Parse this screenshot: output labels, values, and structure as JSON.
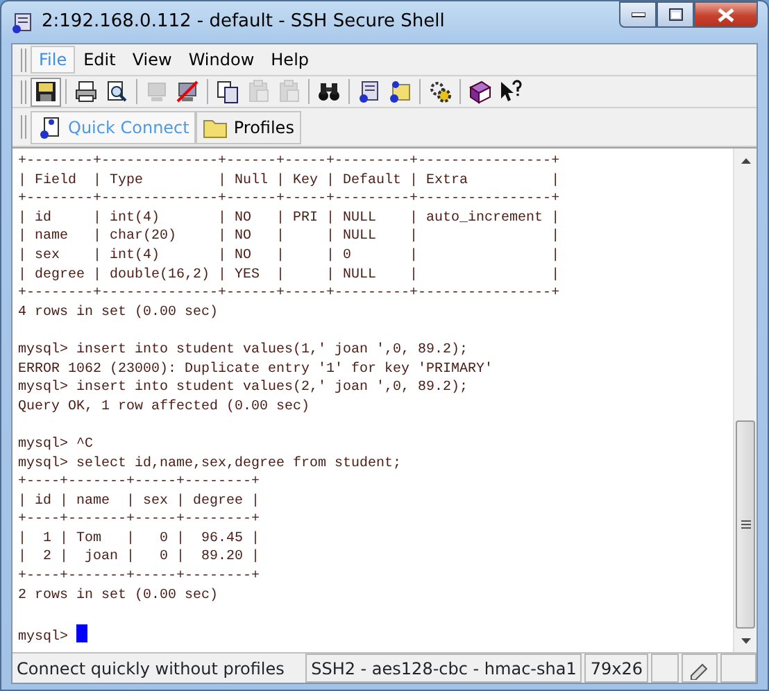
{
  "window": {
    "title": "2:192.168.0.112 - default - SSH Secure Shell"
  },
  "menu": [
    {
      "label": "File",
      "selected": true
    },
    {
      "label": "Edit",
      "selected": false
    },
    {
      "label": "View",
      "selected": false
    },
    {
      "label": "Window",
      "selected": false
    },
    {
      "label": "Help",
      "selected": false
    }
  ],
  "toolbar": [
    {
      "kind": "save",
      "disabled": false
    },
    {
      "kind": "sep"
    },
    {
      "kind": "print",
      "disabled": false
    },
    {
      "kind": "preview",
      "disabled": false
    },
    {
      "kind": "sep"
    },
    {
      "kind": "connect",
      "disabled": true
    },
    {
      "kind": "disconnect",
      "disabled": false
    },
    {
      "kind": "sep"
    },
    {
      "kind": "copy",
      "disabled": false
    },
    {
      "kind": "paste",
      "disabled": true
    },
    {
      "kind": "paste",
      "disabled": true
    },
    {
      "kind": "sep"
    },
    {
      "kind": "find",
      "disabled": false
    },
    {
      "kind": "sep"
    },
    {
      "kind": "terminal",
      "disabled": false
    },
    {
      "kind": "transfer",
      "disabled": false
    },
    {
      "kind": "sep"
    },
    {
      "kind": "settings",
      "disabled": false
    },
    {
      "kind": "sep"
    },
    {
      "kind": "help",
      "disabled": false
    },
    {
      "kind": "whatsthis",
      "disabled": false
    }
  ],
  "tabs": [
    {
      "label": "Quick Connect",
      "kind": "connect",
      "selected": true
    },
    {
      "label": "Profiles",
      "kind": "folder",
      "selected": false
    }
  ],
  "terminal": {
    "blocks": [
      [
        "+--------+--------------+------+-----+---------+----------------+",
        "| Field  | Type         | Null | Key | Default | Extra          |",
        "+--------+--------------+------+-----+---------+----------------+",
        "| id     | int(4)       | NO   | PRI | NULL    | auto_increment |",
        "| name   | char(20)     | NO   |     | NULL    |                |",
        "| sex    | int(4)       | NO   |     | 0       |                |",
        "| degree | double(16,2) | YES  |     | NULL    |                |",
        "+--------+--------------+------+-----+---------+----------------+",
        "4 rows in set (0.00 sec)"
      ],
      [
        "mysql> insert into student values(1,' joan ',0, 89.2);",
        "ERROR 1062 (23000): Duplicate entry '1' for key 'PRIMARY'",
        "mysql> insert into student values(2,' joan ',0, 89.2);",
        "Query OK, 1 row affected (0.00 sec)"
      ],
      [
        "mysql> ^C",
        "mysql> select id,name,sex,degree from student;",
        "+----+-------+-----+--------+",
        "| id | name  | sex | degree |",
        "+----+-------+-----+--------+",
        "|  1 | Tom   |   0 |  96.45 |",
        "|  2 |  joan |   0 |  89.20 |",
        "+----+-------+-----+--------+",
        "2 rows in set (0.00 sec)"
      ]
    ],
    "prompt": "mysql>"
  },
  "status_bar": {
    "message": "Connect quickly without profiles",
    "cipher": "SSH2 - aes128-cbc - hmac-sha1",
    "size": "79x26"
  }
}
